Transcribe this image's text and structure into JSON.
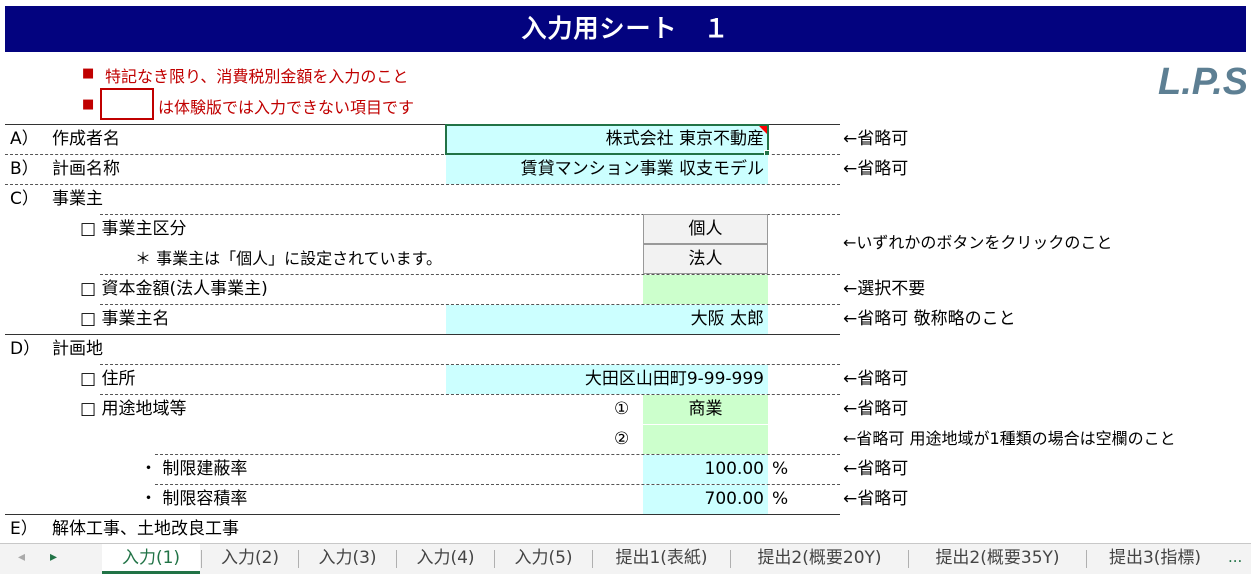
{
  "title": "入力用シート　１",
  "notes": {
    "bullet": "■",
    "note1": "特記なき限り、消費税別金額を入力のこと",
    "note2": "は体験版では入力できない項目です"
  },
  "logo_text": "L.P.S.",
  "rows": {
    "a_label": "A）",
    "a_name": "作成者名",
    "a_value": "株式会社 東京不動産",
    "a_hint": "←省略可",
    "b_label": "B）",
    "b_name": "計画名称",
    "b_value": "賃貸マンション事業 収支モデル",
    "b_hint": "←省略可",
    "c_label": "C）",
    "c_name": "事業主",
    "c1_name": "□ 事業主区分",
    "c1_btn1": "個人",
    "c1_btn2": "法人",
    "c1_hint": "←いずれかのボタンをクリックのこと",
    "c1_note": "＊ 事業主は「個人」に設定されています。",
    "c2_name": "□ 資本金額(法人事業主)",
    "c2_hint": "←選択不要",
    "c3_name": "□ 事業主名",
    "c3_value": "大阪 太郎",
    "c3_hint": "←省略可 敬称略のこと",
    "d_label": "D）",
    "d_name": "計画地",
    "d1_name": "□ 住所",
    "d1_value": "大田区山田町9-99-999",
    "d1_hint": "←省略可",
    "d2_name": "□ 用途地域等",
    "d2_mark1": "①",
    "d2_value1": "商業",
    "d2_hint1": "←省略可",
    "d2_mark2": "②",
    "d2_value2": "",
    "d2_hint2": "←省略可 用途地域が1種類の場合は空欄のこと",
    "d3_name": "・ 制限建蔽率",
    "d3_value": "100.00",
    "d3_unit": "%",
    "d3_hint": "←省略可",
    "d4_name": "・ 制限容積率",
    "d4_value": "700.00",
    "d4_unit": "%",
    "d4_hint": "←省略可",
    "e_label": "E）",
    "e_name": "解体工事、土地改良工事"
  },
  "tabs": [
    {
      "label": "入力(1)",
      "active": true
    },
    {
      "label": "入力(2)"
    },
    {
      "label": "入力(3)"
    },
    {
      "label": "入力(4)"
    },
    {
      "label": "入力(5)"
    },
    {
      "label": "提出1(表紙)"
    },
    {
      "label": "提出2(概要20Y)"
    },
    {
      "label": "提出2(概要35Y)"
    },
    {
      "label": "提出3(指標)"
    }
  ],
  "tab_nav": {
    "prev": "◂",
    "next": "▸",
    "more": "..."
  },
  "colors": {
    "title_bg": "#03037f",
    "note_red": "#c00000",
    "input_cyan": "#ccffff",
    "input_green": "#ccffcc",
    "active_tab": "#217346"
  }
}
